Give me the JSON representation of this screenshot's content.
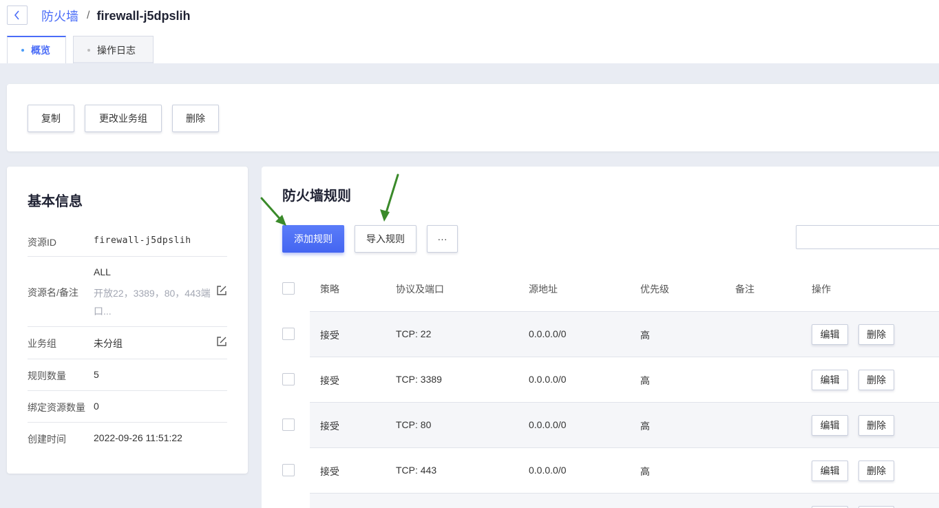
{
  "breadcrumb": {
    "parent": "防火墙",
    "separator": "/",
    "current": "firewall-j5dpslih"
  },
  "tabs": [
    {
      "label": "概览",
      "active": true
    },
    {
      "label": "操作日志",
      "active": false
    }
  ],
  "actions": {
    "copy": "复制",
    "change_group": "更改业务组",
    "delete": "删除"
  },
  "info": {
    "title": "基本信息",
    "rows": [
      {
        "label": "资源ID",
        "value": "firewall-j5dpslih"
      },
      {
        "label": "资源名/备注",
        "value": "ALL",
        "note": "开放22，3389，80，443端口..."
      },
      {
        "label": "业务组",
        "value": "未分组"
      },
      {
        "label": "规则数量",
        "value": "5"
      },
      {
        "label": "绑定资源数量",
        "value": "0"
      },
      {
        "label": "创建时间",
        "value": "2022-09-26 11:51:22"
      }
    ]
  },
  "rules": {
    "title": "防火墙规则",
    "add_label": "添加规则",
    "import_label": "导入规则",
    "more_label": "···",
    "columns": [
      "策略",
      "协议及端口",
      "源地址",
      "优先级",
      "备注",
      "操作"
    ],
    "rows": [
      {
        "policy": "接受",
        "proto": "TCP: 22",
        "source": "0.0.0.0/0",
        "priority": "高",
        "remark": ""
      },
      {
        "policy": "接受",
        "proto": "TCP: 3389",
        "source": "0.0.0.0/0",
        "priority": "高",
        "remark": ""
      },
      {
        "policy": "接受",
        "proto": "TCP: 80",
        "source": "0.0.0.0/0",
        "priority": "高",
        "remark": ""
      },
      {
        "policy": "接受",
        "proto": "TCP: 443",
        "source": "0.0.0.0/0",
        "priority": "高",
        "remark": ""
      }
    ],
    "edit_label": "编辑",
    "delete_label": "删除"
  },
  "colors": {
    "accent": "#4a6cf7",
    "annotation_arrow": "#3a8a2a"
  }
}
